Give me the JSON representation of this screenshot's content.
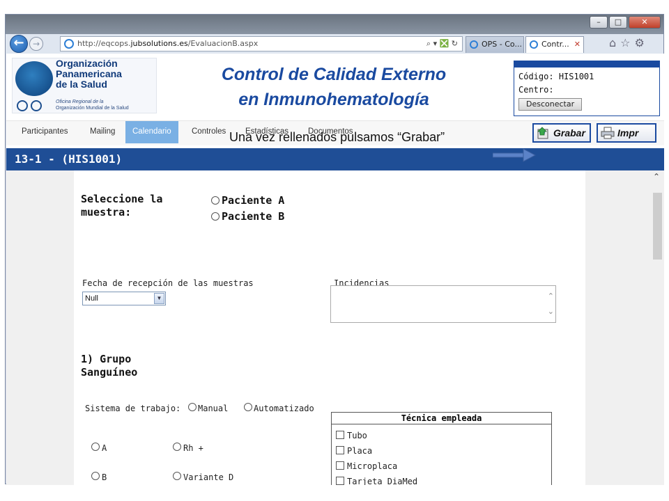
{
  "browser": {
    "url_prefix": "http://eqcops.",
    "url_domain": "jubsolutions.es",
    "url_path": "/EvaluacionB.aspx",
    "url_tools": "⌕ ▾ ❎ ↻",
    "tabs": [
      {
        "label": "OPS - Co..."
      },
      {
        "label": "Contr...",
        "close": "✕"
      }
    ],
    "right_icons": "⌂☆⚙",
    "window_controls": {
      "minimize": "–",
      "maximize": "□",
      "close": "✕"
    }
  },
  "logo": {
    "name_line1": "Organización",
    "name_line2": "Panamericana",
    "name_line3": "de la Salud",
    "sub_line1": "Oficina Regional de la",
    "sub_line2": "Organización Mundial de la Salud"
  },
  "header": {
    "title_line1": "Control de Calidad Externo",
    "title_line2": "en Inmunohematología"
  },
  "userbox": {
    "code_label": "Código:",
    "code_value": "HIS1001",
    "center_label": "Centro:",
    "disconnect": "Desconectar"
  },
  "menu": {
    "items": [
      "Participantes",
      "Mailing",
      "Calendario",
      "Controles",
      "Estadísticas",
      "Documentos"
    ],
    "active": "Calendario"
  },
  "actions": {
    "save": "Grabar",
    "print": "Impr"
  },
  "annotation": "Una vez rellenados pulsamos “Grabar”",
  "section_title": "13-1 - (HIS1001)",
  "form": {
    "sample_label_line1": "Seleccione la",
    "sample_label_line2": "muestra:",
    "patients": [
      "Paciente A",
      "Paciente B"
    ],
    "date_label": "Fecha de recepción de las muestras",
    "date_value": "Null",
    "incidents_label": "Incidencias",
    "group_title_line1": "1) Grupo",
    "group_title_line2": "Sanguíneo",
    "system_label": "Sistema de trabajo:",
    "system_options": [
      "Manual",
      "Automatizado"
    ],
    "group_options_col1": [
      "A",
      "B"
    ],
    "group_options_col2": [
      "Rh +",
      "Variante D"
    ],
    "technique_title": "Técnica empleada",
    "techniques": [
      "Tubo",
      "Placa",
      "Microplaca",
      "Tarjeta DiaMed"
    ]
  },
  "colors": {
    "brand_blue": "#1f4e96",
    "title_blue": "#1a4aa0",
    "menu_active": "#7ab0e4"
  }
}
